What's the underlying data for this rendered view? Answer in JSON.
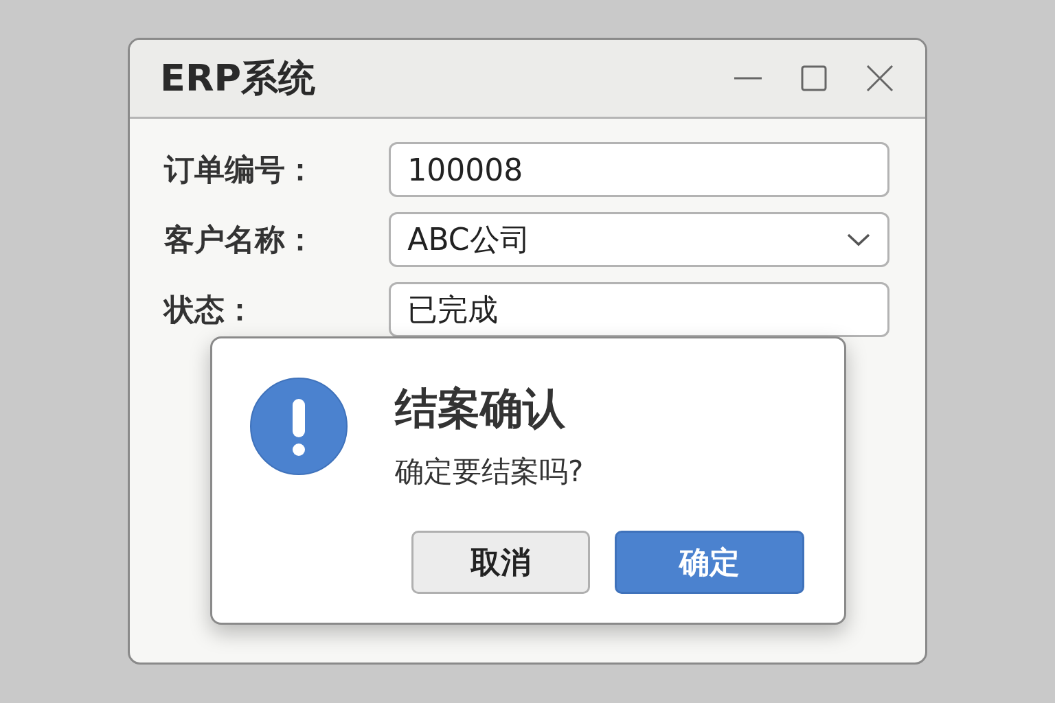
{
  "window": {
    "title": "ERP系统"
  },
  "form": [
    {
      "kind": "text",
      "label": "订单编号：",
      "value": "100008"
    },
    {
      "kind": "dropdown",
      "label": "客户名称：",
      "value": "ABC公司"
    },
    {
      "kind": "text",
      "label": "状态：",
      "value": "已完成"
    }
  ],
  "dialog": {
    "title": "结案确认",
    "message": "确定要结案吗?",
    "buttons": [
      {
        "label": "取消",
        "kind": "secondary"
      },
      {
        "label": "确定",
        "kind": "primary"
      }
    ]
  }
}
